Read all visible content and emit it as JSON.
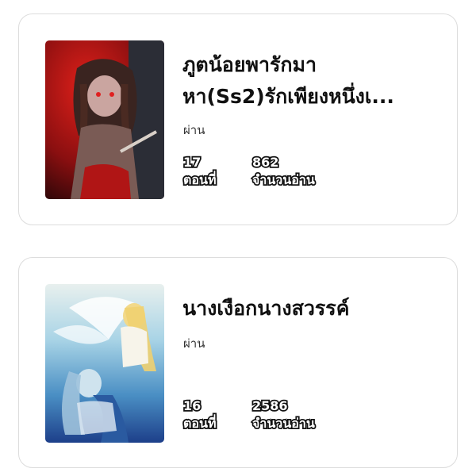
{
  "novels": [
    {
      "title_line1": "ภูตน้อยพารักมา",
      "title_line2": "หา(Ss2)รักเพียงหนึ่งเ...",
      "author": "ผ่าน",
      "episodes": "17",
      "episodes_label": "ตอนที่",
      "reads": "862",
      "reads_label": "จำนวนอ่าน"
    },
    {
      "title_line1": "นางเงือกนางสวรรค์",
      "author": "ผ่าน",
      "episodes": "16",
      "episodes_label": "ตอนที่",
      "reads": "2586",
      "reads_label": "จำนวนอ่าน"
    }
  ]
}
